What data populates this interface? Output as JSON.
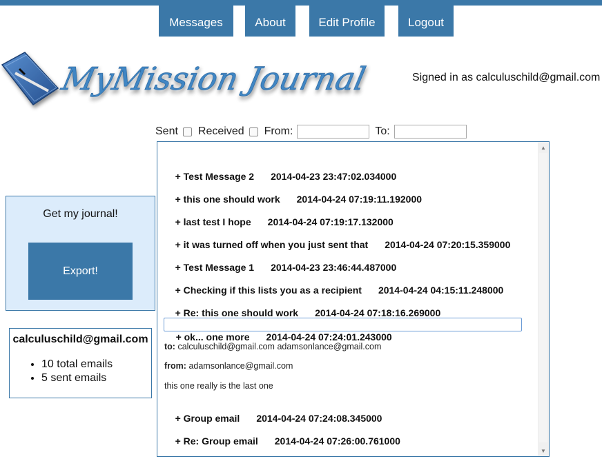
{
  "nav": {
    "messages": "Messages",
    "about": "About",
    "edit_profile": "Edit Profile",
    "logout": "Logout"
  },
  "brand": {
    "logo_text": "MyMission Journal",
    "logo_icon": "notebook-pen-icon"
  },
  "signed_in": "Signed in as calculuschild@gmail.com",
  "filters": {
    "sent_label": "Sent",
    "received_label": "Received",
    "from_label": "From:",
    "to_label": "To:",
    "from_value": "",
    "to_value": ""
  },
  "export": {
    "title": "Get my journal!",
    "button": "Export!"
  },
  "stats": {
    "email": "calculuschild@gmail.com",
    "items": [
      "10 total emails",
      "5 sent emails"
    ]
  },
  "messages": [
    {
      "subject": "+ Test Message 2",
      "date": "2014-04-23 23:47:02.034000"
    },
    {
      "subject": "+ this one should work",
      "date": "2014-04-24 07:19:11.192000"
    },
    {
      "subject": "+ last test I hope",
      "date": "2014-04-24 07:19:17.132000"
    },
    {
      "subject": "+ it was turned off when you just sent that",
      "date": "2014-04-24 07:20:15.359000"
    },
    {
      "subject": "+ Test Message 1",
      "date": "2014-04-23 23:46:44.487000"
    },
    {
      "subject": "+ Checking if this lists you as a recipient",
      "date": "2014-04-24 04:15:11.248000"
    },
    {
      "subject": "+ Re: this one should work",
      "date": "2014-04-24 07:18:16.269000"
    },
    {
      "subject": "+ ok... one more",
      "date": "2014-04-24 07:24:01.243000"
    },
    {
      "subject": "+ Group email",
      "date": "2014-04-24 07:24:08.345000"
    },
    {
      "subject": "+ Re: Group email",
      "date": "2014-04-24 07:26:00.761000"
    }
  ],
  "expanded": {
    "to_label": "to:",
    "to_value": "calculuschild@gmail.com adamsonlance@gmail.com",
    "from_label": "from:",
    "from_value": "adamsonlance@gmail.com",
    "body": "this one really is the last one"
  },
  "colors": {
    "accent": "#3b78a8",
    "panel_bg": "#dcecfb"
  }
}
